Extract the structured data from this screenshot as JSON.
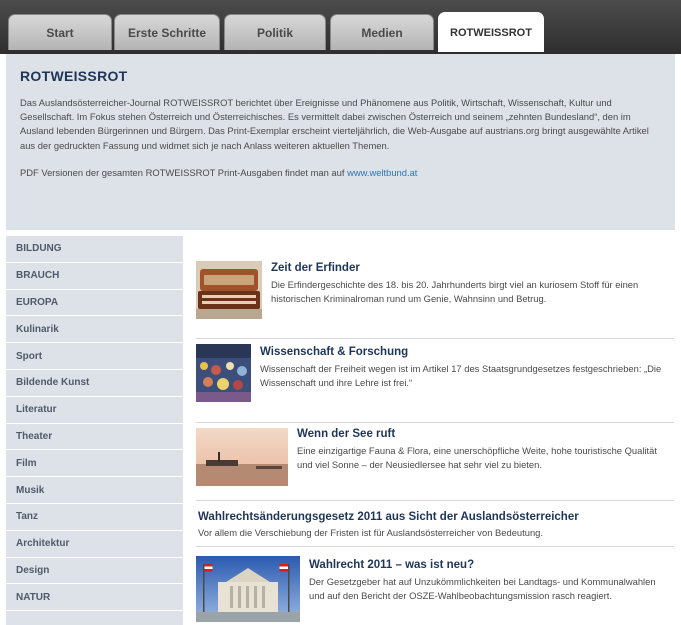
{
  "tabs": [
    {
      "label": "Start"
    },
    {
      "label": "Erste Schritte"
    },
    {
      "label": "Politik"
    },
    {
      "label": "Medien"
    },
    {
      "label": "ROTWEISSROT"
    }
  ],
  "header": {
    "title": "ROTWEISSROT",
    "description": "Das Auslandsösterreicher-Journal ROTWEISSROT berichtet über Ereignisse und Phänomene aus Politik, Wirtschaft, Wissenschaft, Kultur und Gesellschaft. Im Fokus stehen Österreich und Österreichisches. Es vermittelt dabei zwischen Österreich und seinem „zehnten Bundesland“, den im Ausland lebenden Bürgerinnen und Bürgern. Das Print-Exemplar erscheint vierteljährlich, die Web-Ausgabe auf austrians.org bringt ausgewählte Artikel aus der gedruckten Fassung und widmet sich je nach Anlass weiteren aktuellen Themen.",
    "pdf_text": "PDF Versionen der gesamten ROTWEISSROT Print-Ausgaben findet man auf",
    "pdf_link": "www.weltbund.at"
  },
  "sidebar": {
    "items": [
      {
        "label": "BILDUNG"
      },
      {
        "label": "BRAUCH"
      },
      {
        "label": "EUROPA"
      },
      {
        "label": "Kulinarik"
      },
      {
        "label": "Sport"
      },
      {
        "label": "Bildende Kunst"
      },
      {
        "label": "Literatur"
      },
      {
        "label": "Theater"
      },
      {
        "label": "Film"
      },
      {
        "label": "Musik"
      },
      {
        "label": "Tanz"
      },
      {
        "label": "Architektur"
      },
      {
        "label": "Design"
      },
      {
        "label": "NATUR"
      }
    ]
  },
  "articles": [
    {
      "title": "Zeit der Erfinder",
      "text": "Die Erfindergeschichte des 18. bis 20. Jahrhunderts birgt viel an kuriosem Stoff für einen historischen Kriminalroman rund um Genie, Wahnsinn und Betrug."
    },
    {
      "title": "Wissenschaft & Forschung",
      "text": "Wissenschaft der Freiheit wegen ist im Artikel 17 des Staatsgrundgesetzes festgeschrieben: „Die Wissenschaft und ihre Lehre ist frei.“"
    },
    {
      "title": "Wenn der See ruft",
      "text": "Eine einzigartige Fauna & Flora, eine unerschöpfliche Weite, hohe touristische Qualität und viel Sonne – der Neusiedlersee hat sehr viel zu bieten."
    },
    {
      "title": "Wahlrechtsänderungsgesetz 2011 aus Sicht der Auslandsösterreicher",
      "text": "Vor allem die Verschiebung der Fristen ist für Auslandsösterreicher von Bedeutung."
    },
    {
      "title": "Wahlrecht 2011 – was ist neu?",
      "text": "Der Gesetzgeber hat auf Unzukömmlichkeiten bei Landtags- und Kommunalwahlen und auf den Bericht der OSZE-Wahlbeobachtungsmission rasch reagiert."
    }
  ]
}
